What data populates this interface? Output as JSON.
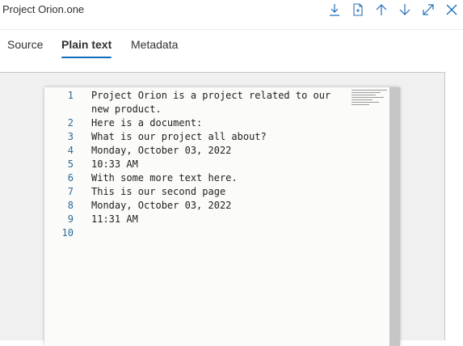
{
  "header": {
    "title": "Project Orion.one",
    "actions": [
      {
        "name": "download-icon",
        "label": "Download"
      },
      {
        "name": "open-file-icon",
        "label": "Open"
      },
      {
        "name": "arrow-up-icon",
        "label": "Previous"
      },
      {
        "name": "arrow-down-icon",
        "label": "Next"
      },
      {
        "name": "expand-icon",
        "label": "Expand"
      },
      {
        "name": "close-icon",
        "label": "Close"
      }
    ]
  },
  "tabs": [
    {
      "label": "Source",
      "active": false
    },
    {
      "label": "Plain text",
      "active": true
    },
    {
      "label": "Metadata",
      "active": false
    }
  ],
  "document": {
    "lines": [
      {
        "num": "1",
        "text": "Project Orion is a project related to our new product."
      },
      {
        "num": "2",
        "text": "Here is a document:"
      },
      {
        "num": "3",
        "text": "What is our project all about?"
      },
      {
        "num": "4",
        "text": "Monday, October 03, 2022"
      },
      {
        "num": "5",
        "text": "10:33 AM"
      },
      {
        "num": "6",
        "text": "With some more text here."
      },
      {
        "num": "7",
        "text": "This is our second page"
      },
      {
        "num": "8",
        "text": "Monday, October 03, 2022"
      },
      {
        "num": "9",
        "text": "11:31 AM"
      },
      {
        "num": "10",
        "text": ""
      }
    ]
  },
  "colors": {
    "accent": "#0f6cbd",
    "icon": "#1f6fb5",
    "line_number": "#2b6a97"
  }
}
